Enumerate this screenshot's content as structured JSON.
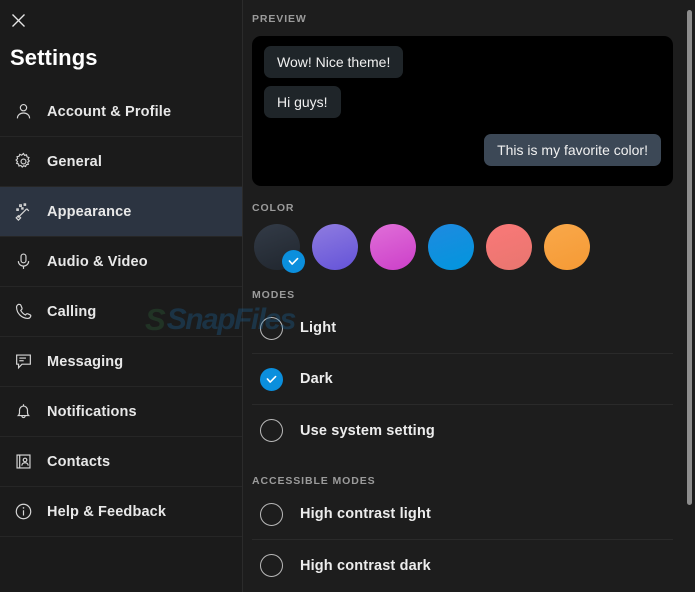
{
  "window": {
    "title": "Settings",
    "close_icon": "close-icon"
  },
  "sidebar": {
    "items": [
      {
        "label": "Account & Profile",
        "icon": "person-icon",
        "active": false
      },
      {
        "label": "General",
        "icon": "gear-icon",
        "active": false
      },
      {
        "label": "Appearance",
        "icon": "magic-wand-icon",
        "active": true
      },
      {
        "label": "Audio & Video",
        "icon": "microphone-icon",
        "active": false
      },
      {
        "label": "Calling",
        "icon": "phone-icon",
        "active": false
      },
      {
        "label": "Messaging",
        "icon": "chat-bubble-icon",
        "active": false
      },
      {
        "label": "Notifications",
        "icon": "bell-icon",
        "active": false
      },
      {
        "label": "Contacts",
        "icon": "contact-card-icon",
        "active": false
      },
      {
        "label": "Help & Feedback",
        "icon": "info-circle-icon",
        "active": false
      }
    ]
  },
  "main": {
    "preview": {
      "section_label": "PREVIEW",
      "messages": [
        {
          "text": "Wow! Nice theme!",
          "direction": "in"
        },
        {
          "text": "Hi guys!",
          "direction": "in"
        },
        {
          "text": "This is my favorite color!",
          "direction": "out"
        }
      ]
    },
    "color": {
      "section_label": "COLOR",
      "swatches": [
        {
          "name": "slate",
          "from": "#333b47",
          "to": "#20262e",
          "selected": true
        },
        {
          "name": "purple",
          "from": "#8f7ce0",
          "to": "#6453d8",
          "selected": false
        },
        {
          "name": "magenta",
          "from": "#e06fd8",
          "to": "#cc3fc9",
          "selected": false
        },
        {
          "name": "blue",
          "from": "#1f8ae0",
          "to": "#0196dd",
          "selected": false
        },
        {
          "name": "red",
          "from": "#fa7878",
          "to": "#e8766f",
          "selected": false
        },
        {
          "name": "orange",
          "from": "#f9a84a",
          "to": "#f59a35",
          "selected": false
        }
      ],
      "selected_badge_color": "#0b8fdd"
    },
    "modes": {
      "section_label": "MODES",
      "options": [
        {
          "label": "Light",
          "selected": false
        },
        {
          "label": "Dark",
          "selected": true
        },
        {
          "label": "Use system setting",
          "selected": false
        }
      ]
    },
    "accessible_modes": {
      "section_label": "ACCESSIBLE MODES",
      "options": [
        {
          "label": "High contrast light",
          "selected": false
        },
        {
          "label": "High contrast dark",
          "selected": false
        }
      ]
    }
  },
  "watermark": {
    "logo": "S",
    "text": "SnapFiles"
  },
  "theme": {
    "accent": "#0b8fdd",
    "sidebar_bg": "#1b1b1b",
    "main_bg": "#1d1d1d",
    "active_item_bg": "#2c3441",
    "preview_bg": "#000000",
    "bubble_in_bg": "#1f2529",
    "bubble_out_bg": "#3c4856"
  }
}
